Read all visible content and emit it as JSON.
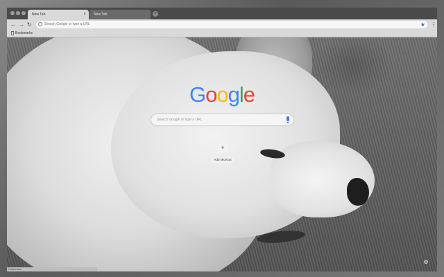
{
  "tabs": [
    {
      "label": "New Tab",
      "close": "×"
    },
    {
      "label": "New Tab",
      "close": "×"
    }
  ],
  "new_tab_symbol": "+",
  "nav": {
    "back": "←",
    "forward": "→",
    "reload": "↻"
  },
  "omnibox": {
    "placeholder": "Search Google or type a URL"
  },
  "star_icon": "★",
  "menu_icon": "⋮",
  "bookmarks": {
    "label": "Bookmarks"
  },
  "logo": {
    "letters": [
      "G",
      "o",
      "o",
      "g",
      "l",
      "e"
    ],
    "colors": [
      "#4285F4",
      "#EA4335",
      "#FBBC05",
      "#4285F4",
      "#34A853",
      "#EA4335"
    ]
  },
  "search": {
    "placeholder": "Search Google or type a URL"
  },
  "shortcut": {
    "icon": "+",
    "label": "Add shortcut"
  },
  "gear_icon": "⚙",
  "statusbar": {
    "text": "Customize"
  }
}
